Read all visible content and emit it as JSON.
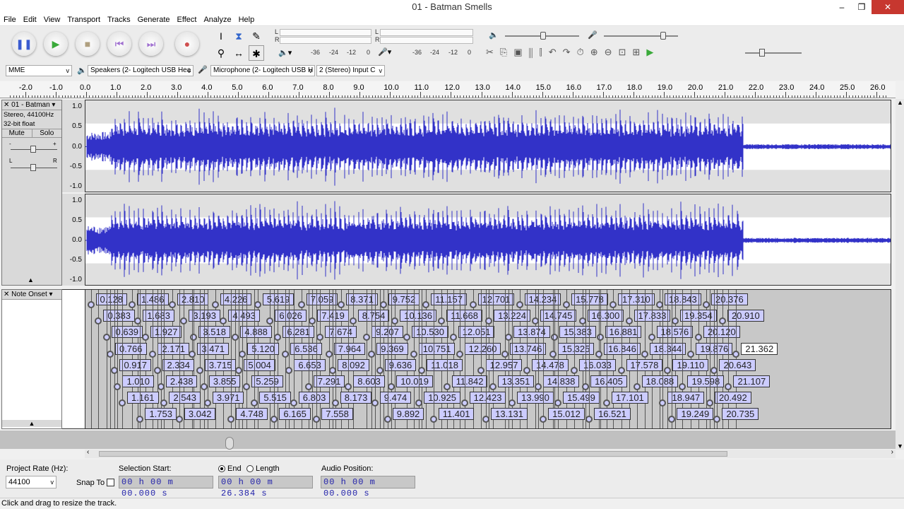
{
  "window": {
    "title": "01 - Batman Smells",
    "min": "–",
    "max": "❐",
    "close": "✕"
  },
  "menu": [
    "File",
    "Edit",
    "View",
    "Transport",
    "Tracks",
    "Generate",
    "Effect",
    "Analyze",
    "Help"
  ],
  "transport": {
    "pause": "pause-icon",
    "play": "play-icon",
    "stop": "stop-icon",
    "skip_start": "skip-start-icon",
    "skip_end": "skip-end-icon",
    "record": "record-icon"
  },
  "meters": {
    "play_ticks": [
      "-36",
      "-24",
      "-12",
      "0"
    ],
    "rec_ticks": [
      "-36",
      "-24",
      "-12",
      "0"
    ],
    "L": "L",
    "R": "R"
  },
  "device": {
    "host": "MME",
    "output": "Speakers (2- Logitech USB Hea",
    "input": "Microphone (2- Logitech USB H",
    "channels": "2 (Stereo) Input C"
  },
  "ruler": {
    "labels": [
      "-2.0",
      "-1.0",
      "0.0",
      "1.0",
      "2.0",
      "3.0",
      "4.0",
      "5.0",
      "6.0",
      "7.0",
      "8.0",
      "9.0",
      "10.0",
      "11.0",
      "12.0",
      "13.0",
      "14.0",
      "15.0",
      "16.0",
      "17.0",
      "18.0",
      "19.0",
      "20.0",
      "21.0",
      "22.0",
      "23.0",
      "24.0",
      "25.0",
      "26.0"
    ]
  },
  "audio_track": {
    "name": "01 - Batman",
    "info1": "Stereo, 44100Hz",
    "info2": "32-bit float",
    "mute": "Mute",
    "solo": "Solo",
    "gain_minus": "-",
    "gain_plus": "+",
    "pan_l": "L",
    "pan_r": "R",
    "scale": [
      "1.0",
      "0.5",
      "0.0",
      "-0.5",
      "-1.0"
    ],
    "wave_color": "#3232c8"
  },
  "label_track": {
    "name": "Note Onset",
    "editing": "21.362",
    "rows": [
      [
        "0.128",
        "1.486",
        "2.810",
        "4.226",
        "5.619",
        "7.059",
        "8.371",
        "9.752",
        "11.157",
        "12.701",
        "14.234",
        "15.778",
        "17.310",
        "18.843",
        "20.376"
      ],
      [
        "0.383",
        "1.683",
        "3.193",
        "4.493",
        "6.026",
        "7.419",
        "8.754",
        "10.136",
        "11.668",
        "13.224",
        "14.745",
        "16.300",
        "17.833",
        "19.354",
        "20.910"
      ],
      [
        "0.639",
        "1.927",
        "3.518",
        "4.888",
        "6.281",
        "7.674",
        "9.207",
        "10.530",
        "12.051",
        "13.874",
        "15.383",
        "16.881",
        "18.576",
        "20.120"
      ],
      [
        "0.766",
        "2.171",
        "3.471",
        "5.120",
        "6.536",
        "7.964",
        "9.369",
        "10.751",
        "12.260",
        "13.746",
        "15.325",
        "16.846",
        "18.344",
        "19.876",
        "21.362"
      ],
      [
        "0.917",
        "2.334",
        "3.715",
        "5.004",
        "6.653",
        "8.092",
        "9.636",
        "11.018",
        "12.957",
        "14.478",
        "16.033",
        "17.578",
        "19.110",
        "20.643"
      ],
      [
        "1.010",
        "2.438",
        "3.855",
        "5.259",
        "7.291",
        "8.603",
        "10.019",
        "11.842",
        "13.351",
        "14.838",
        "16.405",
        "18.088",
        "19.598",
        "21.107"
      ],
      [
        "1.161",
        "2.543",
        "3.971",
        "5.515",
        "6.803",
        "8.173",
        "9.474",
        "10.925",
        "12.423",
        "13.990",
        "15.499",
        "17.101",
        "18.947",
        "20.492"
      ],
      [
        "1.753",
        "3.042",
        "4.748",
        "6.165",
        "7.558",
        "9.892",
        "11.401",
        "13.131",
        "15.012",
        "16.521",
        "19.249",
        "20.735"
      ]
    ]
  },
  "selection": {
    "project_rate_label": "Project Rate (Hz):",
    "project_rate": "44100",
    "snap_to": "Snap To",
    "start_label": "Selection Start:",
    "end_label": "End",
    "length_label": "Length",
    "start": "00 h 00 m 00.000 s",
    "end": "00 h 00 m 26.384 s",
    "audio_pos_label": "Audio Position:",
    "audio_pos": "00 h 00 m 00.000 s"
  },
  "status": "Click and drag to resize the track."
}
